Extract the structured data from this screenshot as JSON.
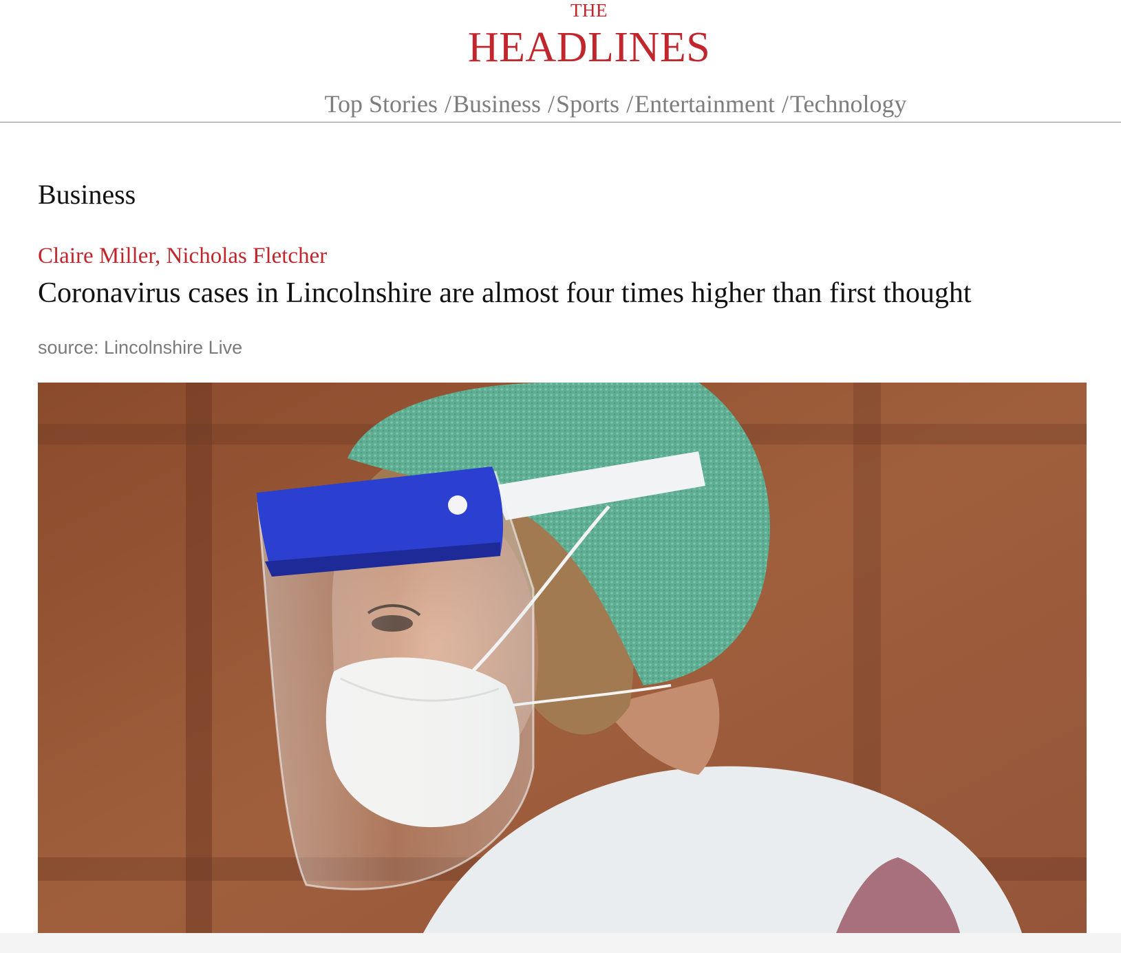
{
  "brand": {
    "the": "THE",
    "name": "HEADLINES",
    "color": "#c0262c"
  },
  "nav": {
    "items": [
      {
        "label": "Top Stories"
      },
      {
        "label": "Business"
      },
      {
        "label": "Sports"
      },
      {
        "label": "Entertainment"
      },
      {
        "label": "Technology"
      }
    ],
    "separator": "/"
  },
  "section": {
    "title": "Business"
  },
  "article": {
    "byline": "Claire Miller, Nicholas Fletcher",
    "headline": "Coronavirus cases in Lincolnshire are almost four times higher than first thought",
    "source": "source: Lincolnshire Live",
    "image_icon": "healthcare-worker-face-shield-photo"
  }
}
